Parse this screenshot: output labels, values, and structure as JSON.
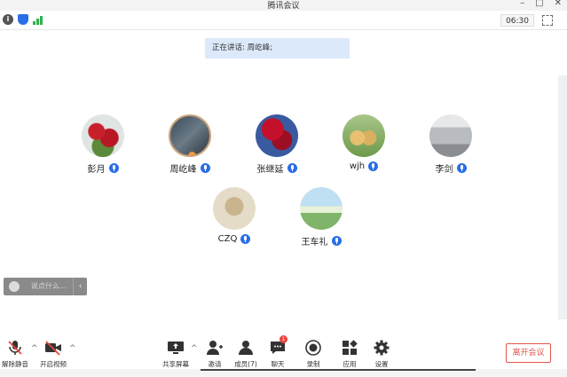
{
  "window": {
    "title": "腾讯会议"
  },
  "infobar": {
    "timer": "06:30"
  },
  "speaking": {
    "text": "正在讲话: 周屹峰;"
  },
  "participants": [
    {
      "name": "彭月"
    },
    {
      "name": "周屹峰"
    },
    {
      "name": "张继延"
    },
    {
      "name": "wjh"
    },
    {
      "name": "李剑"
    },
    {
      "name": "CZQ"
    },
    {
      "name": "王车礼"
    }
  ],
  "chat": {
    "placeholder": "说点什么..."
  },
  "toolbar": {
    "unmute": "解除静音",
    "start_video": "开启视频",
    "share_screen": "共享屏幕",
    "invite": "邀请",
    "members": "成员(7)",
    "chat": "聊天",
    "chat_badge": "1",
    "record": "录制",
    "apps": "应用",
    "settings": "设置",
    "leave": "离开会议"
  },
  "colors": {
    "accent": "#2a6ee8",
    "danger": "#e3564b",
    "banner": "#dce9fb",
    "signal": "#2cb34a"
  }
}
